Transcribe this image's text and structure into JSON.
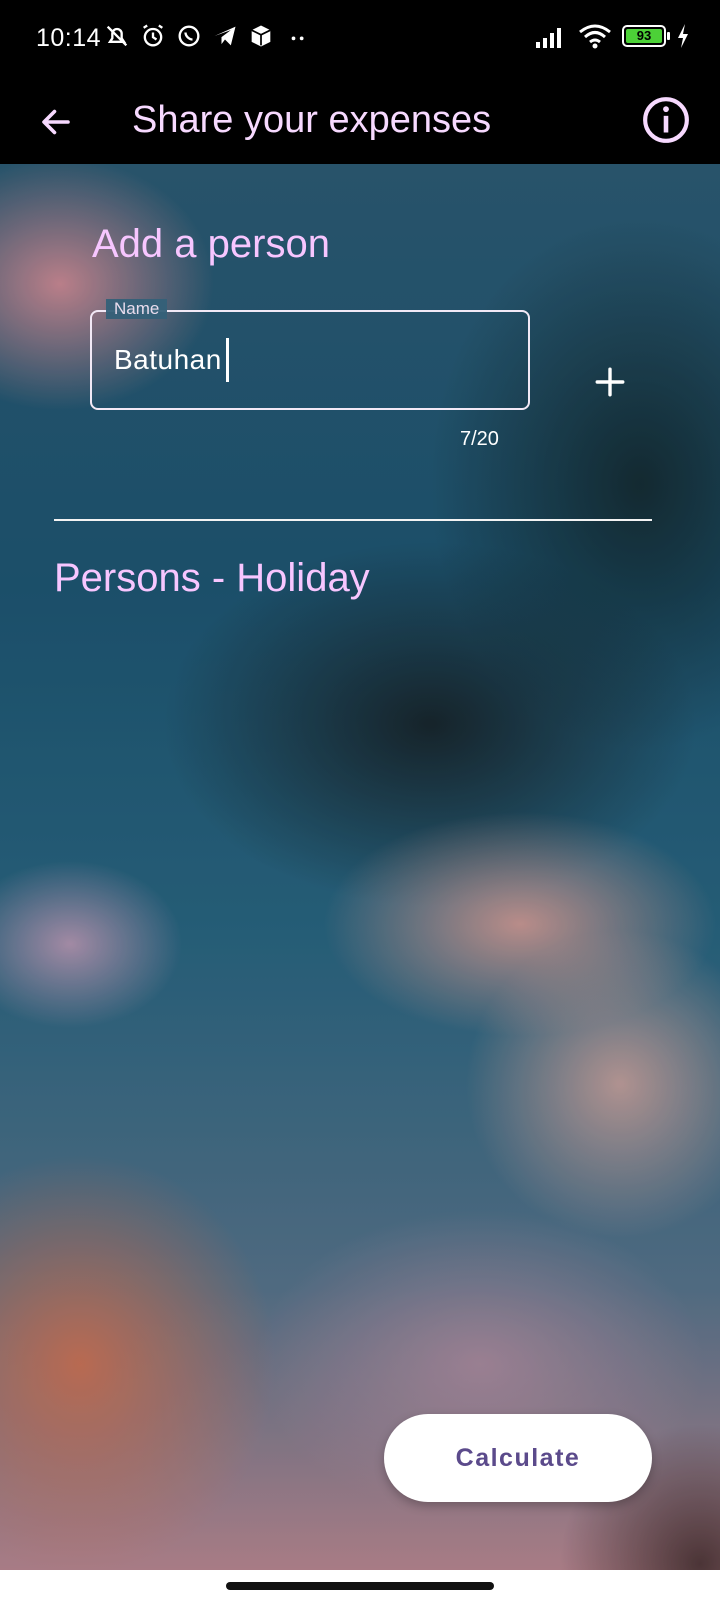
{
  "status_bar": {
    "time": "10:14",
    "battery": "93",
    "icons_left": [
      "mute-icon",
      "alarm-icon",
      "whatsapp-icon",
      "telegram-icon",
      "box-icon",
      "more-dots-icon"
    ],
    "icons_right": [
      "signal-icon",
      "wifi-icon",
      "battery-icon",
      "charging-icon"
    ]
  },
  "app_bar": {
    "title": "Share your expenses",
    "back_icon": "arrow-back-icon",
    "info_icon": "info-icon"
  },
  "add_person": {
    "title": "Add a person",
    "name_label": "Name",
    "name_value": "Batuhan",
    "counter": "7/20",
    "add_icon": "plus-icon"
  },
  "persons": {
    "title": "Persons - Holiday"
  },
  "actions": {
    "calculate_label": "Calculate"
  },
  "colors": {
    "accent_text": "#f7c6ff",
    "button_text": "#5b4a8b"
  }
}
